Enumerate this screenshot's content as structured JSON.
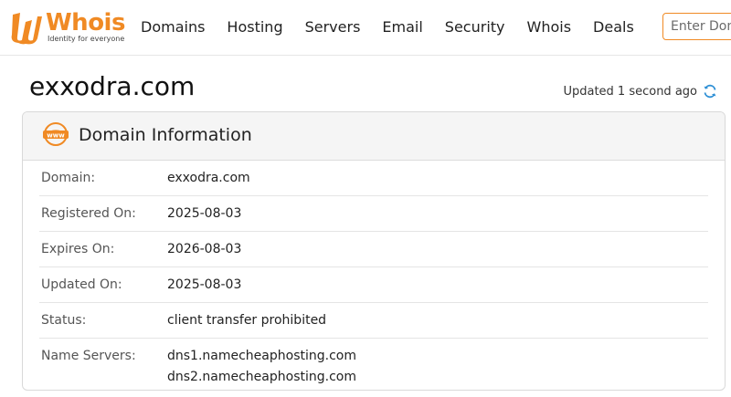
{
  "brand": {
    "name": "Whois",
    "tagline": "Identity for everyone",
    "color": "#f08a24"
  },
  "nav": {
    "items": [
      "Domains",
      "Hosting",
      "Servers",
      "Email",
      "Security",
      "Whois",
      "Deals"
    ]
  },
  "search": {
    "placeholder": "Enter Domain"
  },
  "page": {
    "domain": "exxodra.com",
    "updated_text": "Updated 1 second ago",
    "refresh_icon": "refresh-icon"
  },
  "card": {
    "icon": "www-icon",
    "title": "Domain Information",
    "rows": [
      {
        "label": "Domain:",
        "value": "exxodra.com"
      },
      {
        "label": "Registered On:",
        "value": "2025-08-03"
      },
      {
        "label": "Expires On:",
        "value": "2026-08-03"
      },
      {
        "label": "Updated On:",
        "value": "2025-08-03"
      },
      {
        "label": "Status:",
        "value": "client transfer prohibited"
      }
    ],
    "name_servers": {
      "label": "Name Servers:",
      "values": [
        "dns1.namecheaphosting.com",
        "dns2.namecheaphosting.com"
      ]
    }
  }
}
